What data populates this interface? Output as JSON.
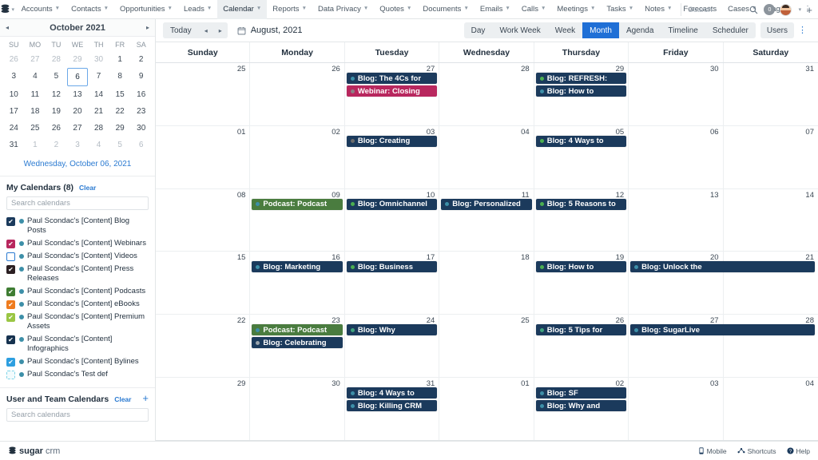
{
  "topnav": {
    "logo_icon": "sugarcrm-stack-logo",
    "items": [
      {
        "label": "Accounts",
        "caret": true
      },
      {
        "label": "Contacts",
        "caret": true
      },
      {
        "label": "Opportunities",
        "caret": true
      },
      {
        "label": "Leads",
        "caret": true
      },
      {
        "label": "Calendar",
        "caret": true,
        "active": true
      },
      {
        "label": "Reports",
        "caret": true
      },
      {
        "label": "Data Privacy",
        "caret": true
      },
      {
        "label": "Quotes",
        "caret": true
      },
      {
        "label": "Documents",
        "caret": true
      },
      {
        "label": "Emails",
        "caret": true
      },
      {
        "label": "Calls",
        "caret": true
      },
      {
        "label": "Meetings",
        "caret": true
      },
      {
        "label": "Tasks",
        "caret": true
      },
      {
        "label": "Notes",
        "caret": true
      },
      {
        "label": "Forecasts",
        "caret": false
      },
      {
        "label": "Cases",
        "caret": true
      },
      {
        "label": "Tags",
        "caret": true
      }
    ],
    "overflow_label": "⋮",
    "search_placeholder": "Search",
    "search_icon": "magnifier-icon",
    "notification_count": "0",
    "profile_caret": "⌄",
    "add_label": "+"
  },
  "sidebar": {
    "minical": {
      "title": "October 2021",
      "prev": "◂",
      "next": "▸",
      "dow": [
        "SU",
        "MO",
        "TU",
        "WE",
        "TH",
        "FR",
        "SA"
      ],
      "days": [
        {
          "n": "26",
          "muted": true
        },
        {
          "n": "27",
          "muted": true
        },
        {
          "n": "28",
          "muted": true
        },
        {
          "n": "29",
          "muted": true
        },
        {
          "n": "30",
          "muted": true
        },
        {
          "n": "1",
          "muted": false
        },
        {
          "n": "2",
          "muted": false
        },
        {
          "n": "3"
        },
        {
          "n": "4"
        },
        {
          "n": "5"
        },
        {
          "n": "6",
          "selected": true
        },
        {
          "n": "7"
        },
        {
          "n": "8"
        },
        {
          "n": "9"
        },
        {
          "n": "10"
        },
        {
          "n": "11"
        },
        {
          "n": "12"
        },
        {
          "n": "13"
        },
        {
          "n": "14"
        },
        {
          "n": "15"
        },
        {
          "n": "16"
        },
        {
          "n": "17"
        },
        {
          "n": "18"
        },
        {
          "n": "19"
        },
        {
          "n": "20"
        },
        {
          "n": "21"
        },
        {
          "n": "22"
        },
        {
          "n": "23"
        },
        {
          "n": "24"
        },
        {
          "n": "25"
        },
        {
          "n": "26"
        },
        {
          "n": "27"
        },
        {
          "n": "28"
        },
        {
          "n": "29"
        },
        {
          "n": "30"
        },
        {
          "n": "31"
        },
        {
          "n": "1",
          "muted": true
        },
        {
          "n": "2",
          "muted": true
        },
        {
          "n": "3",
          "muted": true
        },
        {
          "n": "4",
          "muted": true
        },
        {
          "n": "5",
          "muted": true
        },
        {
          "n": "6",
          "muted": true
        }
      ],
      "selected_label": "Wednesday, October 06, 2021"
    },
    "my_calendars": {
      "title": "My Calendars (8)",
      "clear_label": "Clear",
      "search_placeholder": "Search calendars",
      "items": [
        {
          "label": "Paul Scondac's [Content] Blog Posts",
          "color": "#1b3a5c",
          "state": "checked"
        },
        {
          "label": "Paul Scondac's [Content] Webinars",
          "color": "#b8275e",
          "state": "checked"
        },
        {
          "label": "Paul Scondac's [Content] Videos",
          "color": "#ffffff",
          "state": "unchecked"
        },
        {
          "label": "Paul Scondac's [Content] Press Releases",
          "color": "#2b1f22",
          "state": "checked"
        },
        {
          "label": "Paul Scondac's [Content] Podcasts",
          "color": "#3f7d33",
          "state": "checked"
        },
        {
          "label": "Paul Scondac's [Content] eBooks",
          "color": "#ef7c1f",
          "state": "checked"
        },
        {
          "label": "Paul Scondac's [Content] Premium Assets",
          "color": "#9ac644",
          "state": "checked"
        },
        {
          "label": "Paul Scondac's [Content] Infographics",
          "color": "#16324f",
          "state": "checked"
        },
        {
          "label": "Paul Scondac's [Content] Bylines",
          "color": "#2e9fe0",
          "state": "checked"
        },
        {
          "label": "Paul Scondac's Test def",
          "color": "#eaf9fc",
          "state": "dashed"
        }
      ]
    },
    "team_calendars": {
      "title": "User and Team Calendars",
      "clear_label": "Clear",
      "add_label": "+",
      "search_placeholder": "Search calendars"
    }
  },
  "toolbar": {
    "today_label": "Today",
    "prev_label": "◂",
    "next_label": "▸",
    "calendar_icon": "calendar-icon",
    "current_label": "August, 2021",
    "views": [
      {
        "label": "Day",
        "active": false
      },
      {
        "label": "Work Week",
        "active": false
      },
      {
        "label": "Week",
        "active": false
      },
      {
        "label": "Month",
        "active": true
      },
      {
        "label": "Agenda",
        "active": false
      },
      {
        "label": "Timeline",
        "active": false
      },
      {
        "label": "Scheduler",
        "active": false
      }
    ],
    "users_label": "Users",
    "kebab_label": "⋮"
  },
  "calendar": {
    "day_headers": [
      "Sunday",
      "Monday",
      "Tuesday",
      "Wednesday",
      "Thursday",
      "Friday",
      "Saturday"
    ],
    "weeks": [
      {
        "days": [
          {
            "num": "25",
            "events": []
          },
          {
            "num": "26",
            "events": []
          },
          {
            "num": "27",
            "events": [
              {
                "title": "Blog: The 4Cs for",
                "bg": "#1b3a5c",
                "dot": "#3d8fa8"
              },
              {
                "title": "Webinar: Closing",
                "bg": "#b8275e",
                "dot": "#8c7f86"
              }
            ]
          },
          {
            "num": "28",
            "events": []
          },
          {
            "num": "29",
            "events": [
              {
                "title": "Blog: REFRESH:",
                "bg": "#1b3a5c",
                "dot": "#4caf50"
              },
              {
                "title": "Blog: How to",
                "bg": "#1b3a5c",
                "dot": "#3d8fa8"
              }
            ]
          },
          {
            "num": "30",
            "events": []
          },
          {
            "num": "31",
            "events": []
          }
        ]
      },
      {
        "days": [
          {
            "num": "01",
            "events": []
          },
          {
            "num": "02",
            "events": []
          },
          {
            "num": "03",
            "events": [
              {
                "title": "Blog: Creating",
                "bg": "#1b3a5c",
                "dot": "#6b6b6b"
              }
            ]
          },
          {
            "num": "04",
            "events": []
          },
          {
            "num": "05",
            "events": [
              {
                "title": "Blog: 4 Ways to",
                "bg": "#1b3a5c",
                "dot": "#4caf50"
              }
            ]
          },
          {
            "num": "06",
            "events": []
          },
          {
            "num": "07",
            "events": []
          }
        ]
      },
      {
        "days": [
          {
            "num": "08",
            "events": []
          },
          {
            "num": "09",
            "events": [
              {
                "title": "Podcast: Podcast",
                "bg": "#4a7c3f",
                "dot": "#3d8fa8"
              }
            ]
          },
          {
            "num": "10",
            "events": [
              {
                "title": "Blog: Omnichannel",
                "bg": "#1b3a5c",
                "dot": "#4caf50"
              }
            ]
          },
          {
            "num": "11",
            "events": [
              {
                "title": "Blog: Personalized",
                "bg": "#1b3a5c",
                "dot": "#3d8fa8"
              }
            ]
          },
          {
            "num": "12",
            "events": [
              {
                "title": "Blog: 5 Reasons to",
                "bg": "#1b3a5c",
                "dot": "#4caf50"
              }
            ]
          },
          {
            "num": "13",
            "events": []
          },
          {
            "num": "14",
            "events": []
          }
        ]
      },
      {
        "days": [
          {
            "num": "15",
            "events": []
          },
          {
            "num": "16",
            "events": [
              {
                "title": "Blog: Marketing",
                "bg": "#1b3a5c",
                "dot": "#3d8fa8"
              }
            ]
          },
          {
            "num": "17",
            "events": [
              {
                "title": "Blog: Business",
                "bg": "#1b3a5c",
                "dot": "#4caf50"
              }
            ]
          },
          {
            "num": "18",
            "events": []
          },
          {
            "num": "19",
            "events": [
              {
                "title": "Blog: How to",
                "bg": "#1b3a5c",
                "dot": "#4caf50"
              }
            ]
          },
          {
            "num": "20",
            "events": [
              {
                "title": "Blog: Unlock the",
                "bg": "#1b3a5c",
                "dot": "#3d8fa8",
                "wide": true
              }
            ]
          },
          {
            "num": "21",
            "events": []
          }
        ]
      },
      {
        "days": [
          {
            "num": "22",
            "events": []
          },
          {
            "num": "23",
            "events": [
              {
                "title": "Podcast: Podcast",
                "bg": "#4a7c3f",
                "dot": "#3d8fa8"
              },
              {
                "title": "Blog: Celebrating",
                "bg": "#1b3a5c",
                "dot": "#9aa4ad"
              }
            ]
          },
          {
            "num": "24",
            "events": [
              {
                "title": "Blog: Why",
                "bg": "#1b3a5c",
                "dot": "#3fa37e"
              }
            ]
          },
          {
            "num": "25",
            "events": []
          },
          {
            "num": "26",
            "events": [
              {
                "title": "Blog: 5 Tips for",
                "bg": "#1b3a5c",
                "dot": "#3fa37e"
              }
            ]
          },
          {
            "num": "27",
            "events": [
              {
                "title": "Blog: SugarLive",
                "bg": "#1b3a5c",
                "dot": "#3d8fa8",
                "wide": true
              }
            ]
          },
          {
            "num": "28",
            "events": []
          }
        ]
      },
      {
        "days": [
          {
            "num": "29",
            "events": []
          },
          {
            "num": "30",
            "events": []
          },
          {
            "num": "31",
            "events": [
              {
                "title": "Blog: 4 Ways to",
                "bg": "#1b3a5c",
                "dot": "#3d8fa8"
              },
              {
                "title": "Blog: Killing CRM",
                "bg": "#1b3a5c",
                "dot": "#3d8fa8"
              }
            ]
          },
          {
            "num": "01",
            "events": []
          },
          {
            "num": "02",
            "events": [
              {
                "title": "Blog: SF",
                "bg": "#1b3a5c",
                "dot": "#3d8fa8"
              },
              {
                "title": "Blog: Why and",
                "bg": "#1b3a5c",
                "dot": "#3d8fa8"
              }
            ]
          },
          {
            "num": "03",
            "events": []
          },
          {
            "num": "04",
            "events": []
          }
        ]
      }
    ]
  },
  "footer": {
    "brand_bold": "sugar",
    "brand_light": "crm",
    "links": [
      {
        "label": "Mobile",
        "icon": "mobile-icon"
      },
      {
        "label": "Shortcuts",
        "icon": "shortcuts-icon"
      },
      {
        "label": "Help",
        "icon": "help-icon"
      }
    ]
  }
}
